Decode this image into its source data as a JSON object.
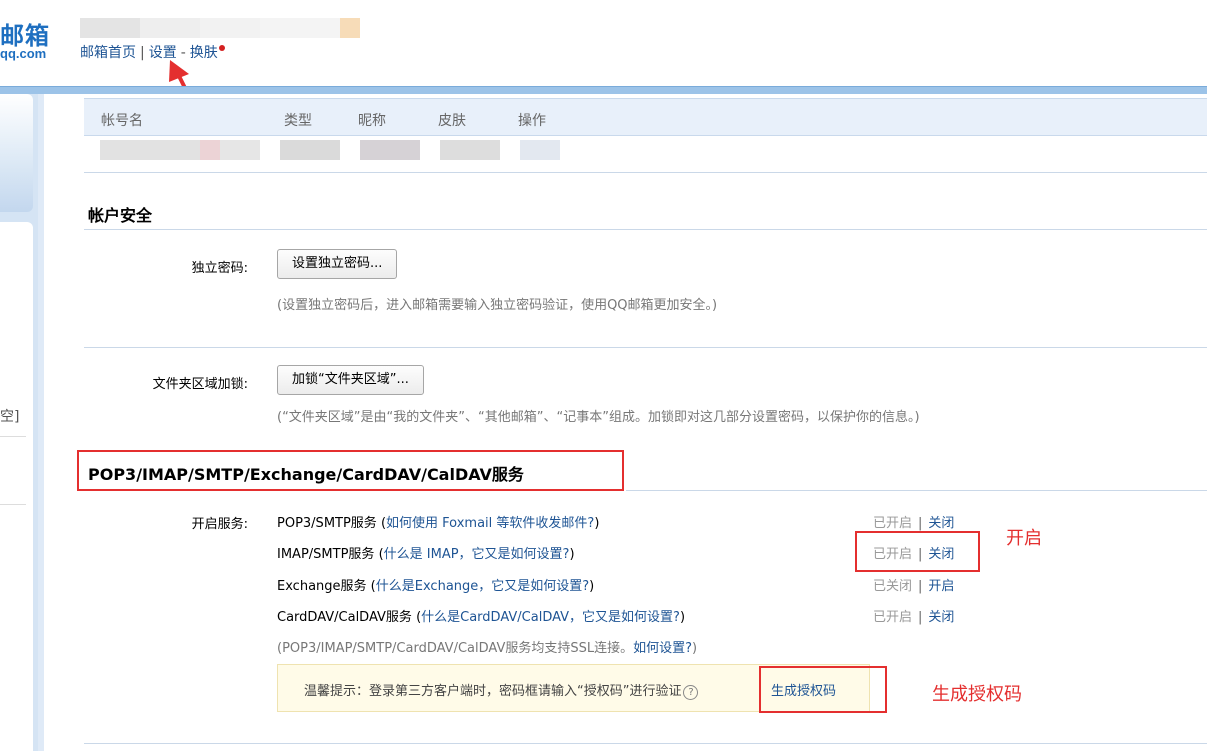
{
  "header": {
    "logo_main": "邮箱",
    "logo_sub": "qq.com",
    "nav": {
      "home": "邮箱首页",
      "separator": "|",
      "settings": "设置",
      "dash": "-",
      "skin": "换肤"
    }
  },
  "sidebar": {
    "fragment": "空]"
  },
  "account_table": {
    "columns": [
      "帐号名",
      "类型",
      "昵称",
      "皮肤",
      "操作"
    ]
  },
  "account_security": {
    "title": "帐户安全",
    "independent_password": {
      "label": "独立密码:",
      "button": "设置独立密码...",
      "hint": "(设置独立密码后，进入邮箱需要输入独立密码验证，使用QQ邮箱更加安全。)"
    },
    "folder_lock": {
      "label": "文件夹区域加锁:",
      "button": "加锁“文件夹区域”...",
      "hint": "(“文件夹区域”是由“我的文件夹”、“其他邮箱”、“记事本”组成。加锁即对这几部分设置密码，以保护你的信息。)"
    }
  },
  "protocols": {
    "title": "POP3/IMAP/SMTP/Exchange/CardDAV/CalDAV服务",
    "label": "开启服务:",
    "services": [
      {
        "name": "POP3/SMTP服务",
        "open_paren": "(",
        "help": "如何使用 Foxmail 等软件收发邮件?",
        "close_paren": ")",
        "status": "已开启",
        "sep": "|",
        "action": "关闭"
      },
      {
        "name": "IMAP/SMTP服务",
        "open_paren": "(",
        "help": "什么是 IMAP，它又是如何设置?",
        "close_paren": ")",
        "status": "已开启",
        "sep": "|",
        "action": "关闭"
      },
      {
        "name": "Exchange服务",
        "open_paren": "(",
        "help": "什么是Exchange，它又是如何设置?",
        "close_paren": ")",
        "status": "已关闭",
        "sep": "|",
        "action": "开启"
      },
      {
        "name": "CardDAV/CalDAV服务",
        "open_paren": "(",
        "help": "什么是CardDAV/CalDAV，它又是如何设置?",
        "close_paren": ")",
        "status": "已开启",
        "sep": "|",
        "action": "关闭"
      }
    ],
    "ssl_note": "(POP3/IMAP/SMTP/CardDAV/CalDAV服务均支持SSL连接。",
    "ssl_link": "如何设置?",
    "ssl_close": ")",
    "tip": {
      "text": "温馨提示：登录第三方客户端时，密码框请输入“授权码”进行验证",
      "qmark": "?",
      "link": "生成授权码"
    }
  },
  "annotations": {
    "open_label": "开启",
    "generate_label": "生成授权码",
    "color": "#e42f2f"
  }
}
